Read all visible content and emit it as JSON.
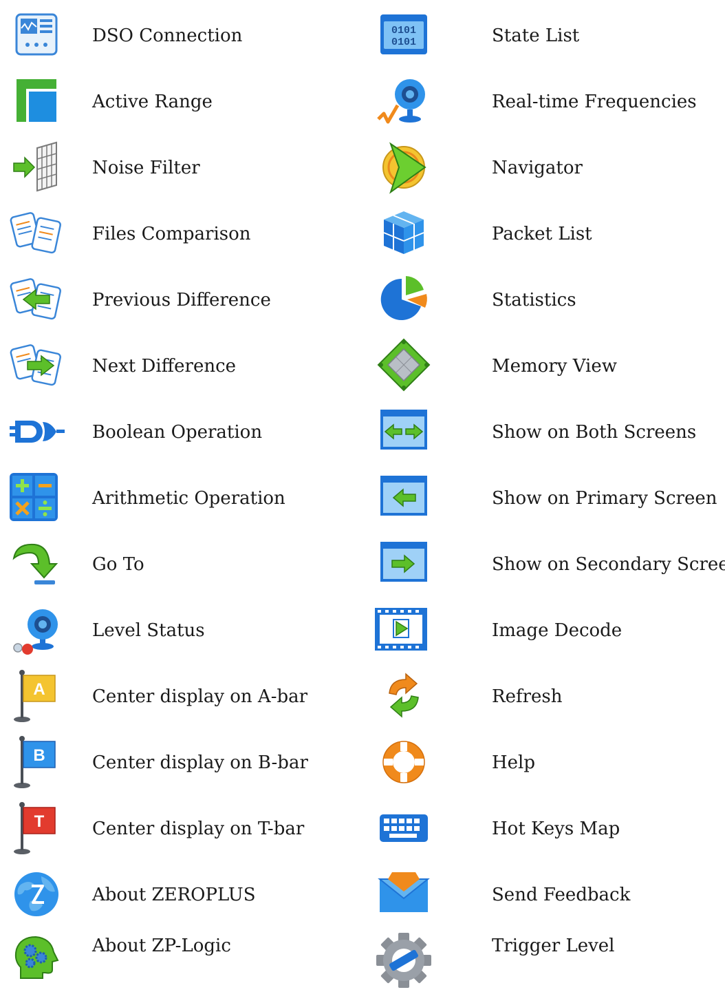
{
  "legend": {
    "left": [
      {
        "icon": "dso-connection-icon",
        "label": "DSO Connection"
      },
      {
        "icon": "active-range-icon",
        "label": "Active Range"
      },
      {
        "icon": "noise-filter-icon",
        "label": "Noise Filter"
      },
      {
        "icon": "files-comparison-icon",
        "label": "Files Comparison"
      },
      {
        "icon": "previous-difference-icon",
        "label": "Previous Difference"
      },
      {
        "icon": "next-difference-icon",
        "label": "Next Difference"
      },
      {
        "icon": "boolean-operation-icon",
        "label": "Boolean Operation"
      },
      {
        "icon": "arithmetic-operation-icon",
        "label": "Arithmetic Operation"
      },
      {
        "icon": "go-to-icon",
        "label": "Go To"
      },
      {
        "icon": "level-status-icon",
        "label": "Level Status"
      },
      {
        "icon": "flag-a-icon",
        "label": "Center display on A-bar"
      },
      {
        "icon": "flag-b-icon",
        "label": "Center display on B-bar"
      },
      {
        "icon": "flag-t-icon",
        "label": "Center display on T-bar"
      },
      {
        "icon": "globe-icon",
        "label": "About ZEROPLUS"
      },
      {
        "icon": "head-gears-icon",
        "label": "About ZP-Logic"
      }
    ],
    "right": [
      {
        "icon": "binary-list-icon",
        "label": "State List",
        "icon_text": "0101"
      },
      {
        "icon": "webcam-chart-icon",
        "label": "Real-time Frequencies"
      },
      {
        "icon": "navigator-arrow-icon",
        "label": "Navigator"
      },
      {
        "icon": "cube-icon",
        "label": "Packet List"
      },
      {
        "icon": "pie-chart-icon",
        "label": "Statistics"
      },
      {
        "icon": "chip-diamond-icon",
        "label": "Memory View"
      },
      {
        "icon": "screen-both-icon",
        "label": "Show on Both Screens"
      },
      {
        "icon": "screen-primary-icon",
        "label": "Show on Primary Screen"
      },
      {
        "icon": "screen-secondary-icon",
        "label": "Show on Secondary Screen"
      },
      {
        "icon": "film-play-icon",
        "label": "Image Decode"
      },
      {
        "icon": "refresh-icon",
        "label": "Refresh"
      },
      {
        "icon": "lifebuoy-icon",
        "label": "Help"
      },
      {
        "icon": "keyboard-icon",
        "label": "Hot Keys Map"
      },
      {
        "icon": "envelope-icon",
        "label": "Send Feedback"
      },
      {
        "icon": "gear-icon",
        "label": "Trigger Level"
      }
    ]
  },
  "flag_letters": {
    "a": "A",
    "b": "B",
    "t": "T"
  },
  "colors": {
    "blue": "#1e73d6",
    "light_blue": "#63b4f0",
    "green": "#5cbf2a",
    "orange": "#f08a1c",
    "red": "#e23b2e",
    "yellow": "#f4c430",
    "gray": "#8a8f96"
  }
}
